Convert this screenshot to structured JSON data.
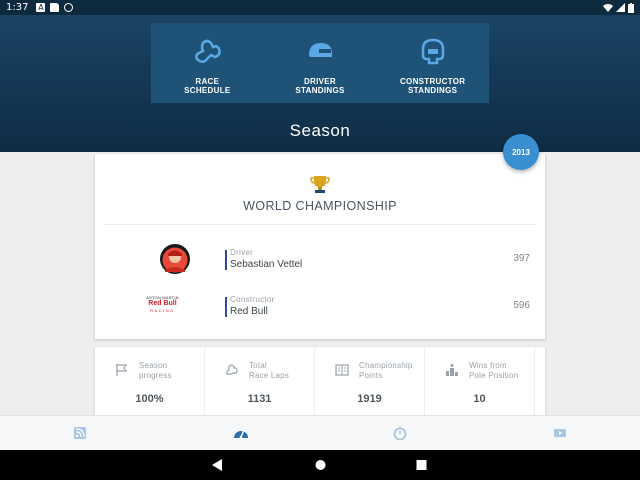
{
  "status_bar": {
    "time": "1:37"
  },
  "top_nav": [
    {
      "label_line1": "RACE",
      "label_line2": "SCHEDULE",
      "icon": "track-icon"
    },
    {
      "label_line1": "DRIVER",
      "label_line2": "STANDINGS",
      "icon": "helmet-icon"
    },
    {
      "label_line1": "CONSTRUCTOR",
      "label_line2": "STANDINGS",
      "icon": "steering-wheel-icon"
    }
  ],
  "season_title": "Season",
  "year": "2013",
  "championship": {
    "title": "WORLD CHAMPIONSHIP",
    "driver": {
      "caption": "Driver",
      "name": "Sebastian Vettel",
      "points": "397"
    },
    "constructor": {
      "caption": "Constructor",
      "name": "Red Bull",
      "points": "596",
      "logo_text_top": "ASTON MARTIN",
      "logo_text_main": "Red Bull",
      "logo_text_bottom": "RACING"
    }
  },
  "stats": [
    {
      "label_line1": "Season",
      "label_line2": "progress",
      "value": "100%",
      "icon": "flag-icon"
    },
    {
      "label_line1": "Total",
      "label_line2": "Race Laps",
      "value": "1131",
      "icon": "laps-icon"
    },
    {
      "label_line1": "Championship",
      "label_line2": "Points",
      "value": "1919",
      "icon": "points-icon"
    },
    {
      "label_line1": "Wins from",
      "label_line2": "Pole Position",
      "value": "10",
      "icon": "podium-icon"
    }
  ],
  "bottom_nav": [
    "rss-icon",
    "speedometer-icon",
    "stopwatch-icon",
    "video-icon"
  ],
  "colors": {
    "header": "#153a58",
    "accent": "#3a8fd0",
    "active_tab": "#2a6fa8"
  }
}
